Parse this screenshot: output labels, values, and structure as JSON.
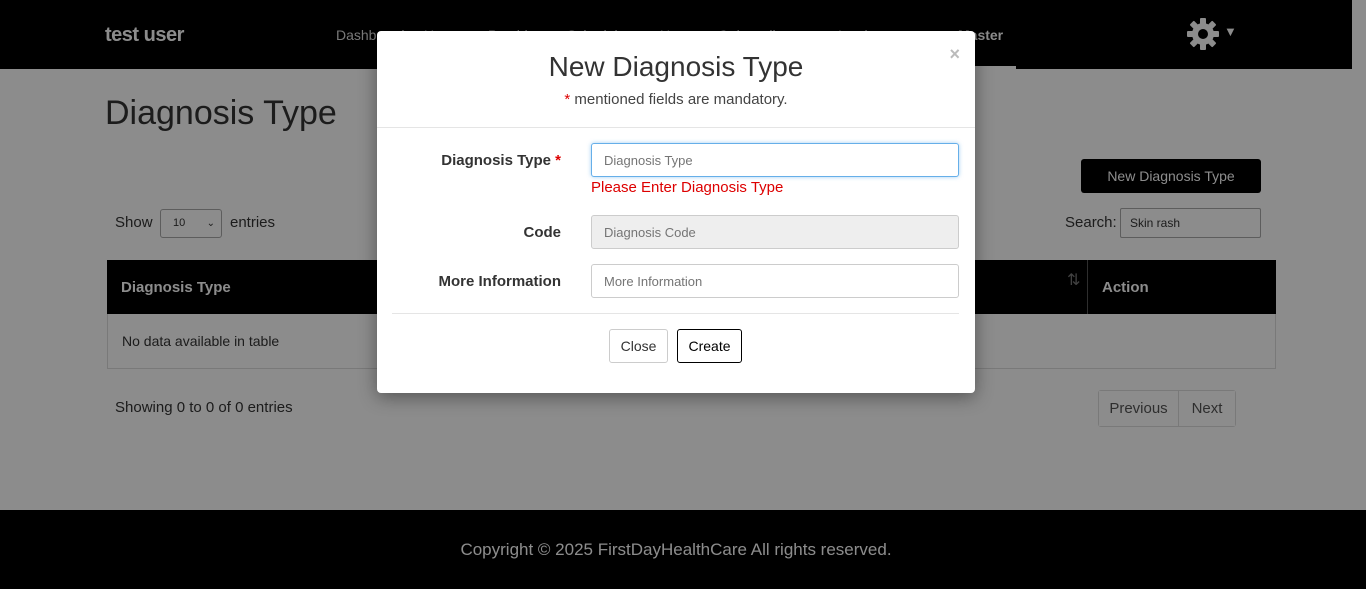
{
  "navbar": {
    "brand": "test user",
    "items": [
      {
        "label": "Dashboard",
        "active": false
      },
      {
        "label": "Users",
        "active": false
      },
      {
        "label": "Providers",
        "active": false
      },
      {
        "label": "Schedule",
        "active": false
      },
      {
        "label": "Users",
        "active": false
      },
      {
        "label": "Onboarding",
        "active": false
      },
      {
        "label": "Invoice",
        "active": false
      },
      {
        "label": "Master",
        "active": true
      }
    ],
    "settings_icon": "gear-icon",
    "caret_icon": "caret-down-icon"
  },
  "page": {
    "title": "Diagnosis Type",
    "new_button_label": "New Diagnosis Type",
    "show_label": "Show",
    "entries_value": "10",
    "entries_label": "entries",
    "search_label": "Search:",
    "search_value": "Skin rash",
    "table": {
      "columns": [
        "Diagnosis Type",
        "Action"
      ],
      "empty_message": "No data available in table"
    },
    "info": "Showing 0 to 0 of 0 entries",
    "pager": {
      "previous": "Previous",
      "next": "Next"
    }
  },
  "footer": {
    "text": "Copyright © 2025 FirstDayHealthCare All rights reserved."
  },
  "modal": {
    "title": "New Diagnosis Type",
    "required_mark": "*",
    "subtitle": " mentioned fields are mandatory.",
    "close_symbol": "×",
    "fields": {
      "diagnosis_type": {
        "label": "Diagnosis Type",
        "placeholder": "Diagnosis Type",
        "error": "Please Enter Diagnosis Type"
      },
      "code": {
        "label": "Code",
        "placeholder": "Diagnosis Code"
      },
      "more_info": {
        "label": "More Information",
        "placeholder": "More Information"
      }
    },
    "close_button": "Close",
    "create_button": "Create"
  },
  "colors": {
    "navbar_bg": "#000000",
    "error": "#dd0000",
    "focus_border": "#66afe9"
  }
}
